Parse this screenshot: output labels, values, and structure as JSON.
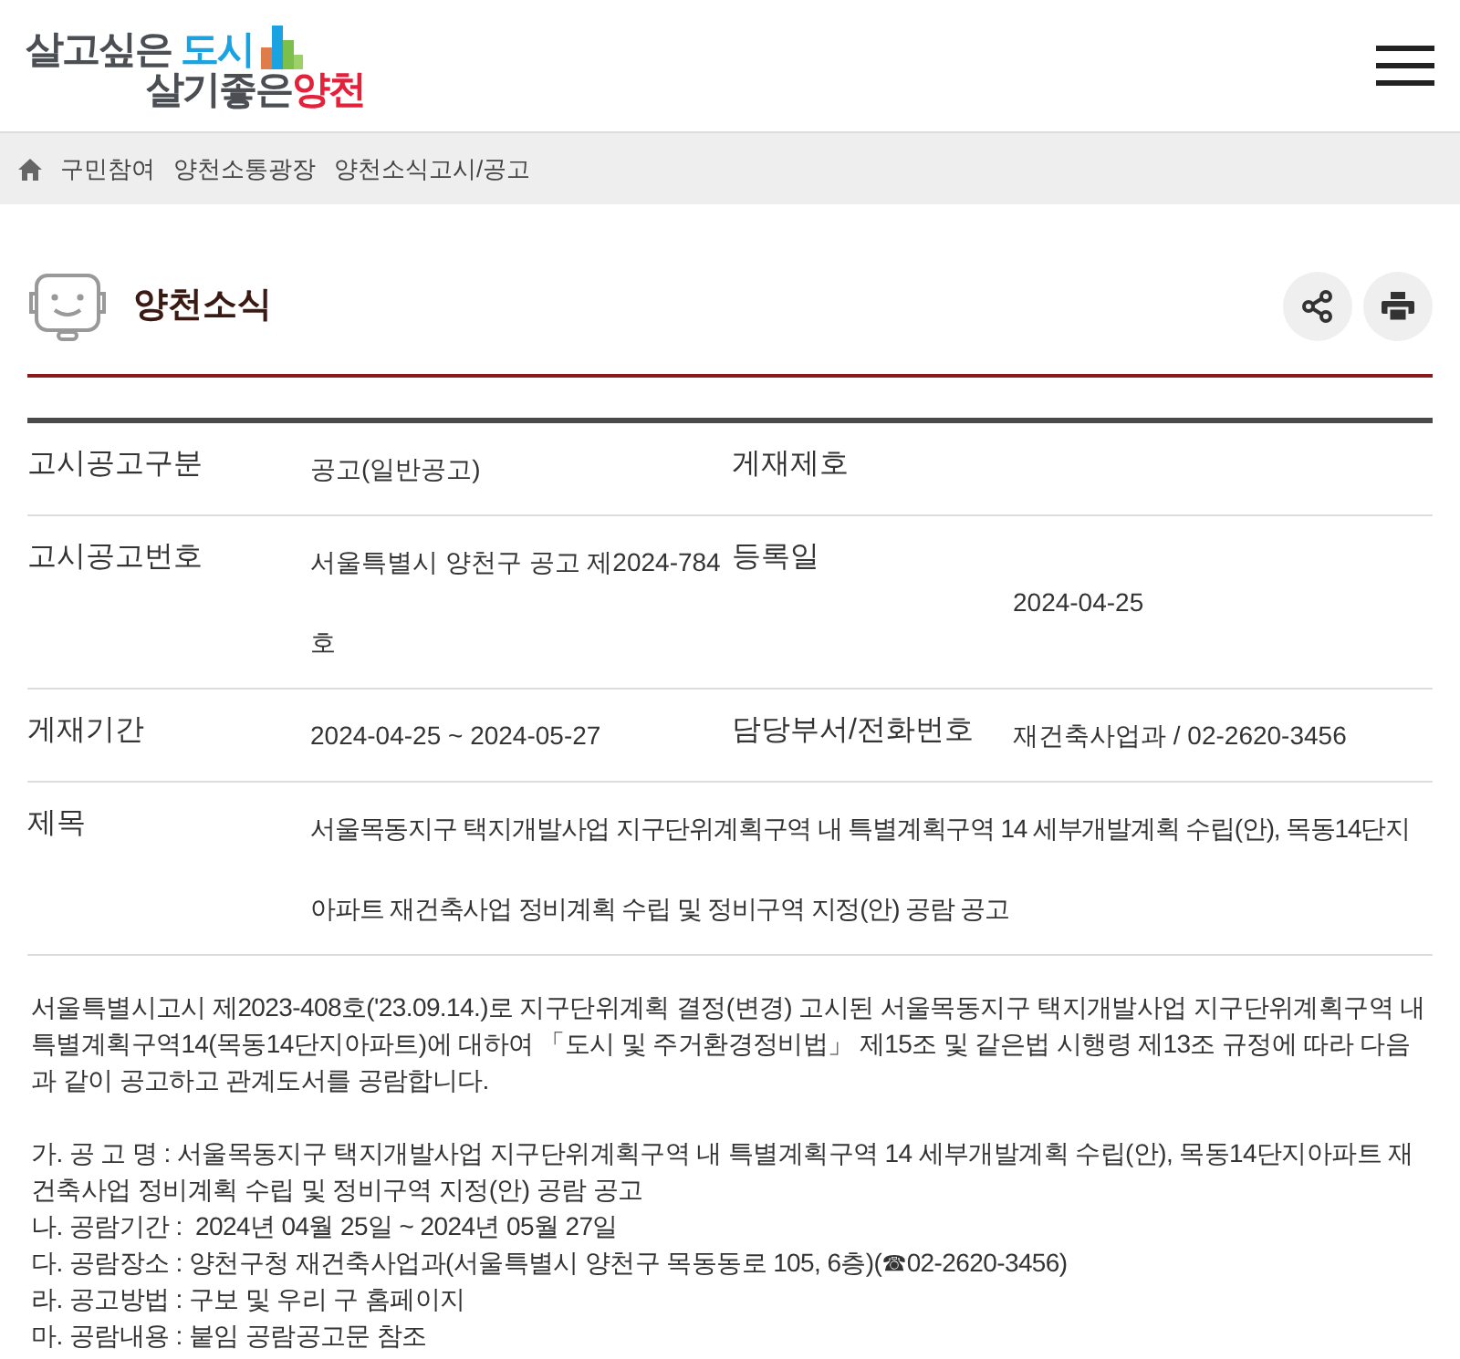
{
  "logo": {
    "line1": [
      "살고싶은",
      "도시"
    ],
    "line2": [
      "살기좋은",
      "양천"
    ]
  },
  "breadcrumb": [
    "구민참여",
    "양천소통광장",
    "양천소식고시/공고"
  ],
  "page_title": "양천소식",
  "info_table": [
    {
      "label": "고시공고구분",
      "value": "공고(일반공고)",
      "label_2": "게재제호"
    },
    {
      "label": "고시공고번호",
      "value": "서울특별시 양천구 공고 제2024-784호",
      "label_2": "등록일",
      "value_2": "2024-04-25"
    },
    {
      "label": "게재기간",
      "value": "2024-04-25 ~ 2024-05-27",
      "label_2": "담당부서/전화번호",
      "value_2": "재건축사업과 / 02-2620-3456"
    },
    {
      "label": "제목",
      "value": "서울목동지구 택지개발사업 지구단위계획구역 내 특별계획구역 14 세부개발계획 수립(안), 목동14단지아파트 재건축사업 정비계획 수립 및 정비구역 지정(안) 공람 공고"
    }
  ],
  "body_intro": "서울특별시고시 제2023-408호('23.09.14.)로 지구단위계획 결정(변경) 고시된 서울목동지구 택지개발사업 지구단위계획구역 내 특별계획구역14(목동14단지아파트)에 대하여 「도시 및 주거환경정비법」 제15조 및 같은법 시행령 제13조 규정에 따라  다음과 같이 공고하고 관계도서를 공람합니다.",
  "body_items": [
    "가. 공 고 명 : 서울목동지구 택지개발사업 지구단위계획구역 내 특별계획구역 14 세부개발계획 수립(안), 목동14단지아파트 재건축사업 정비계획 수립 및 정비구역 지정(안) 공람 공고",
    "나. 공람기간 :  2024년 04월 25일 ~ 2024년 05월 27일",
    "다. 공람장소 : 양천구청 재건축사업과(서울특별시 양천구 목동동로 105, 6층)(☎02-2620-3456)",
    "라. 공고방법 : 구보 및 우리 구 홈페이지",
    "마. 공람내용 : 붙임 공람공고문 참조"
  ]
}
